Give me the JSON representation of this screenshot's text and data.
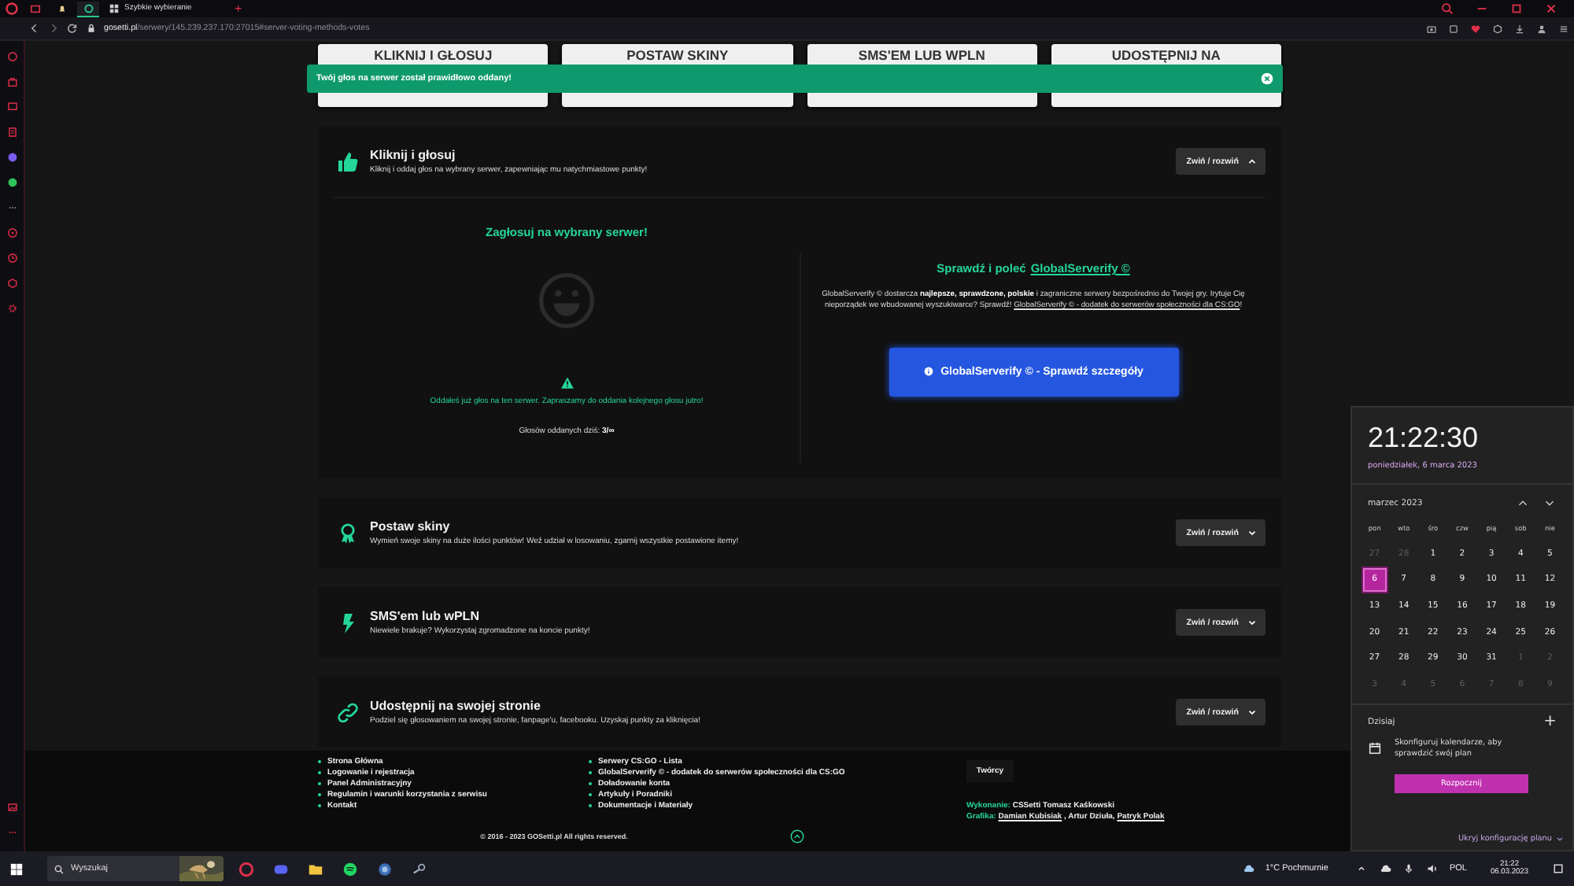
{
  "browser": {
    "tabs": [
      {
        "kind": "mail",
        "selected": false
      },
      {
        "kind": "bell",
        "selected": false
      },
      {
        "kind": "ring",
        "selected": true
      },
      {
        "kind": "grid",
        "title": "Szybkie wybieranie",
        "selected": false
      }
    ],
    "new_tab": "+",
    "address": "**gosetti.pl**/serwery/145.239.237.170:27015#server-voting-methods-votes"
  },
  "top_cards": [
    "KLIKNIJ I GŁOSUJ",
    "POSTAW SKINY",
    "SMS'EM LUB WPLN",
    "UDOSTĘPNIJ NA"
  ],
  "toast": {
    "message": "Twój głos na serwer został prawidłowo oddany!"
  },
  "sections": [
    {
      "kind": "thumb",
      "title": "Kliknij i głosuj",
      "subtitle": "Kliknij i oddaj głos na wybrany serwer, zapewniając mu natychmiastowe punkty!",
      "toggle": "Zwiń / rozwiń",
      "expanded": true
    },
    {
      "kind": "award",
      "title": "Postaw skiny",
      "subtitle": "Wymień swoje skiny na duże ilości punktów! Weź udział w losowaniu, zgarnij wszystkie postawione itemy!",
      "toggle": "Zwiń / rozwiń",
      "expanded": false
    },
    {
      "kind": "bolt",
      "title": "SMS'em lub wPLN",
      "subtitle": "Niewiele brakuje? Wykorzystaj zgromadzone na koncie punkty!",
      "toggle": "Zwiń / rozwiń",
      "expanded": false
    },
    {
      "kind": "link",
      "title": "Udostępnij na swojej stronie",
      "subtitle": "Podziel się głosowaniem na swojej stronie, fanpage'u, facebooku. Uzyskaj punkty za kliknięcia!",
      "toggle": "Zwiń / rozwiń",
      "expanded": false
    }
  ],
  "vote": {
    "heading": "Zagłosuj na wybrany serwer!",
    "message": "Oddałeś już głos na ten serwer. Zapraszamy do oddania kolejnego głosu jutro!",
    "count": "Głosów oddanych dziś: **3/∞**"
  },
  "promo": {
    "heading": "Sprawdź i poleć",
    "heading_link": "GlobalServerify ©",
    "text": "GlobalServerify © dostarcza **najlepsze, sprawdzone, polskie** i zagraniczne serwery bezpośrednio do Twojej gry. Irytuje Cię nieporządek we wbudowanej wyszukiwarce? Sprawdź!",
    "text_link": "GlobalServerify © - dodatek do serwerów społeczności dla CS:GO",
    "text_end": "!",
    "button": "GlobalServerify © - Sprawdź szczegóły"
  },
  "footer": {
    "links_1": [
      "Strona Główna",
      "Logowanie i rejestracja",
      "Panel Administracyjny",
      "Regulamin i warunki korzystania z serwisu",
      "Kontakt"
    ],
    "links_2": [
      "Serwery CS:GO - Lista",
      "GlobalServerify © - dodatek do serwerów społeczności dla CS:GO",
      "Doładowanie konta",
      "Artykuły i Poradniki",
      "Dokumentacje i Materiały"
    ],
    "creators_title": "Twórcy",
    "credits": [
      {
        "label": "Wykonanie:",
        "parts": [
          {
            "text": "CSSetti Tomasz Kaśkowski",
            "link": false
          }
        ]
      },
      {
        "label": "Grafika:",
        "parts": [
          {
            "text": "Damian Kubisiak",
            "link": true
          },
          {
            "text": ", Artur Dziuła,",
            "link": false
          },
          {
            "text": "Patryk Polak",
            "link": true
          }
        ]
      }
    ],
    "copyright": "© 2016 - 2023 GOSetti.pl All rights reserved."
  },
  "calendar": {
    "time": "21:22:30",
    "date": "poniedziałek, 6 marca 2023",
    "month": "marzec 2023",
    "weekdays": [
      "pon",
      "wto",
      "śro",
      "czw",
      "pią",
      "sob",
      "nie"
    ],
    "days": [
      {
        "day": "27",
        "muted": true,
        "selected": false
      },
      {
        "day": "28",
        "muted": true,
        "selected": false
      },
      {
        "day": "1",
        "muted": false,
        "selected": false
      },
      {
        "day": "2",
        "muted": false,
        "selected": false
      },
      {
        "day": "3",
        "muted": false,
        "selected": false
      },
      {
        "day": "4",
        "muted": false,
        "selected": false
      },
      {
        "day": "5",
        "muted": false,
        "selected": false
      },
      {
        "day": "6",
        "muted": false,
        "selected": true
      },
      {
        "day": "7",
        "muted": false,
        "selected": false
      },
      {
        "day": "8",
        "muted": false,
        "selected": false
      },
      {
        "day": "9",
        "muted": false,
        "selected": false
      },
      {
        "day": "10",
        "muted": false,
        "selected": false
      },
      {
        "day": "11",
        "muted": false,
        "selected": false
      },
      {
        "day": "12",
        "muted": false,
        "selected": false
      },
      {
        "day": "13",
        "muted": false,
        "selected": false
      },
      {
        "day": "14",
        "muted": false,
        "selected": false
      },
      {
        "day": "15",
        "muted": false,
        "selected": false
      },
      {
        "day": "16",
        "muted": false,
        "selected": false
      },
      {
        "day": "17",
        "muted": false,
        "selected": false
      },
      {
        "day": "18",
        "muted": false,
        "selected": false
      },
      {
        "day": "19",
        "muted": false,
        "selected": false
      },
      {
        "day": "20",
        "muted": false,
        "selected": false
      },
      {
        "day": "21",
        "muted": false,
        "selected": false
      },
      {
        "day": "22",
        "muted": false,
        "selected": false
      },
      {
        "day": "23",
        "muted": false,
        "selected": false
      },
      {
        "day": "24",
        "muted": false,
        "selected": false
      },
      {
        "day": "25",
        "muted": false,
        "selected": false
      },
      {
        "day": "26",
        "muted": false,
        "selected": false
      },
      {
        "day": "27",
        "muted": false,
        "selected": false
      },
      {
        "day": "28",
        "muted": false,
        "selected": false
      },
      {
        "day": "29",
        "muted": false,
        "selected": false
      },
      {
        "day": "30",
        "muted": false,
        "selected": false
      },
      {
        "day": "31",
        "muted": false,
        "selected": false
      },
      {
        "day": "1",
        "muted": true,
        "selected": false
      },
      {
        "day": "2",
        "muted": true,
        "selected": false
      },
      {
        "day": "3",
        "muted": true,
        "selected": false
      },
      {
        "day": "4",
        "muted": true,
        "selected": false
      },
      {
        "day": "5",
        "muted": true,
        "selected": false
      },
      {
        "day": "6",
        "muted": true,
        "selected": false
      },
      {
        "day": "7",
        "muted": true,
        "selected": false
      },
      {
        "day": "8",
        "muted": true,
        "selected": false
      },
      {
        "day": "9",
        "muted": true,
        "selected": false
      }
    ],
    "today_label": "Dzisiaj",
    "add": "+",
    "hint": "Skonfiguruj kalendarze, aby sprawdzić swój plan",
    "start_button": "Rozpocznij",
    "hide_link": "Ukryj konfigurację planu"
  },
  "taskbar": {
    "search": "Wyszukaj",
    "weather": "1°C Pochmurnie",
    "language": "POL",
    "time": "21:22",
    "date": "06.03.2023"
  }
}
